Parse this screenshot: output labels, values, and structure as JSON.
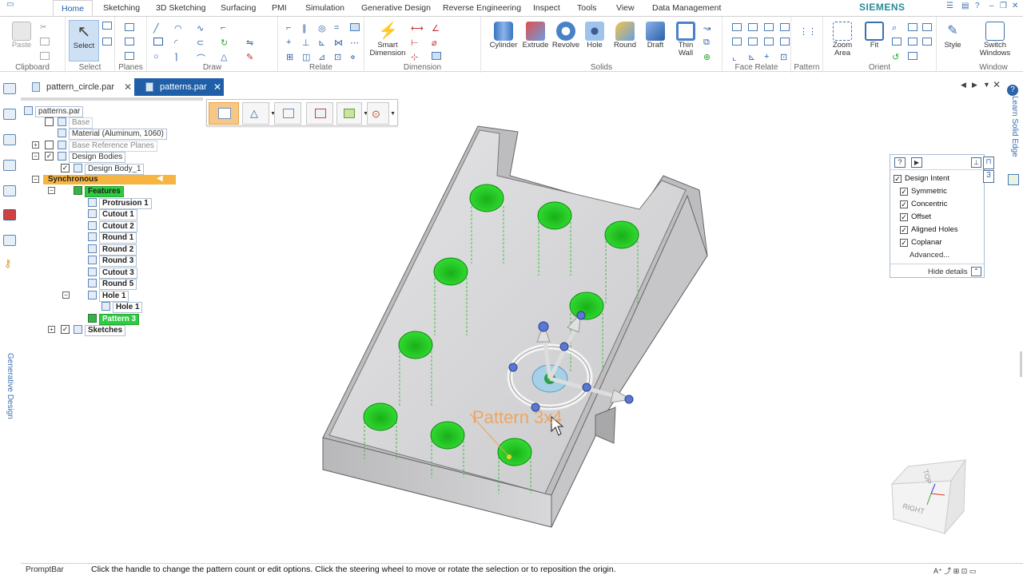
{
  "brand": "SIEMENS",
  "ribbon_tabs": [
    "Home",
    "Sketching",
    "3D Sketching",
    "Surfacing",
    "PMI",
    "Simulation",
    "Generative Design",
    "Reverse Engineering",
    "Inspect",
    "Tools",
    "View",
    "Data Management"
  ],
  "ribbon_groups": {
    "clipboard": {
      "label": "Clipboard",
      "paste": "Paste"
    },
    "select": {
      "label": "Select",
      "button": "Select"
    },
    "planes": {
      "label": "Planes"
    },
    "draw": {
      "label": "Draw"
    },
    "relate": {
      "label": "Relate"
    },
    "dimension": {
      "label": "Dimension",
      "smart": "Smart",
      "dimension": "Dimension"
    },
    "solids": {
      "label": "Solids",
      "cylinder": "Cylinder",
      "extrude": "Extrude",
      "revolve": "Revolve",
      "hole": "Hole",
      "round": "Round",
      "draft": "Draft",
      "thin": "Thin",
      "wall": "Wall"
    },
    "face_relate": {
      "label": "Face Relate"
    },
    "pattern": {
      "label": "Pattern"
    },
    "orient": {
      "label": "Orient",
      "zoom": "Zoom",
      "area": "Area",
      "fit": "Fit"
    },
    "window": {
      "label": "Window",
      "style": "Style",
      "switch": "Switch",
      "windows": "Windows"
    }
  },
  "doc_tabs": [
    "pattern_circle.par",
    "patterns.par"
  ],
  "tree": {
    "root": "patterns.par",
    "base": "Base",
    "material": "Material (Aluminum, 1060)",
    "base_ref_planes": "Base Reference Planes",
    "design_bodies": "Design Bodies",
    "design_body_1": "Design Body_1",
    "synchronous": "Synchronous",
    "features": "Features",
    "items": [
      "Protrusion 1",
      "Cutout 1",
      "Cutout 2",
      "Round 1",
      "Round 2",
      "Round 3",
      "Cutout 3",
      "Round 5"
    ],
    "hole_group": "Hole 1",
    "hole_child": "Hole 1",
    "pattern": "Pattern 3",
    "sketches": "Sketches"
  },
  "intent_panel": {
    "title": "Design Intent",
    "options": [
      "Symmetric",
      "Concentric",
      "Offset",
      "Aligned Holes",
      "Coplanar"
    ],
    "advanced": "Advanced...",
    "hide": "Hide details",
    "badge": "3"
  },
  "viewport": {
    "pattern_label": "Pattern 3x4",
    "cube_top": "TOP",
    "cube_right": "RIGHT"
  },
  "left_rail_label": "Generative Design",
  "right_rail_label": "Learn Solid Edge",
  "status": {
    "label": "PromptBar",
    "prompt": "Click the handle to change the pattern count or edit options. Click the steering wheel to move or rotate the selection or to reposition the origin."
  },
  "colors": {
    "accent": "#1f5fa8",
    "hole_green": "#1dd31d",
    "sync_orange": "#f8b440",
    "part_gray": "#c6c6c9",
    "label_orange": "#f0a050"
  }
}
